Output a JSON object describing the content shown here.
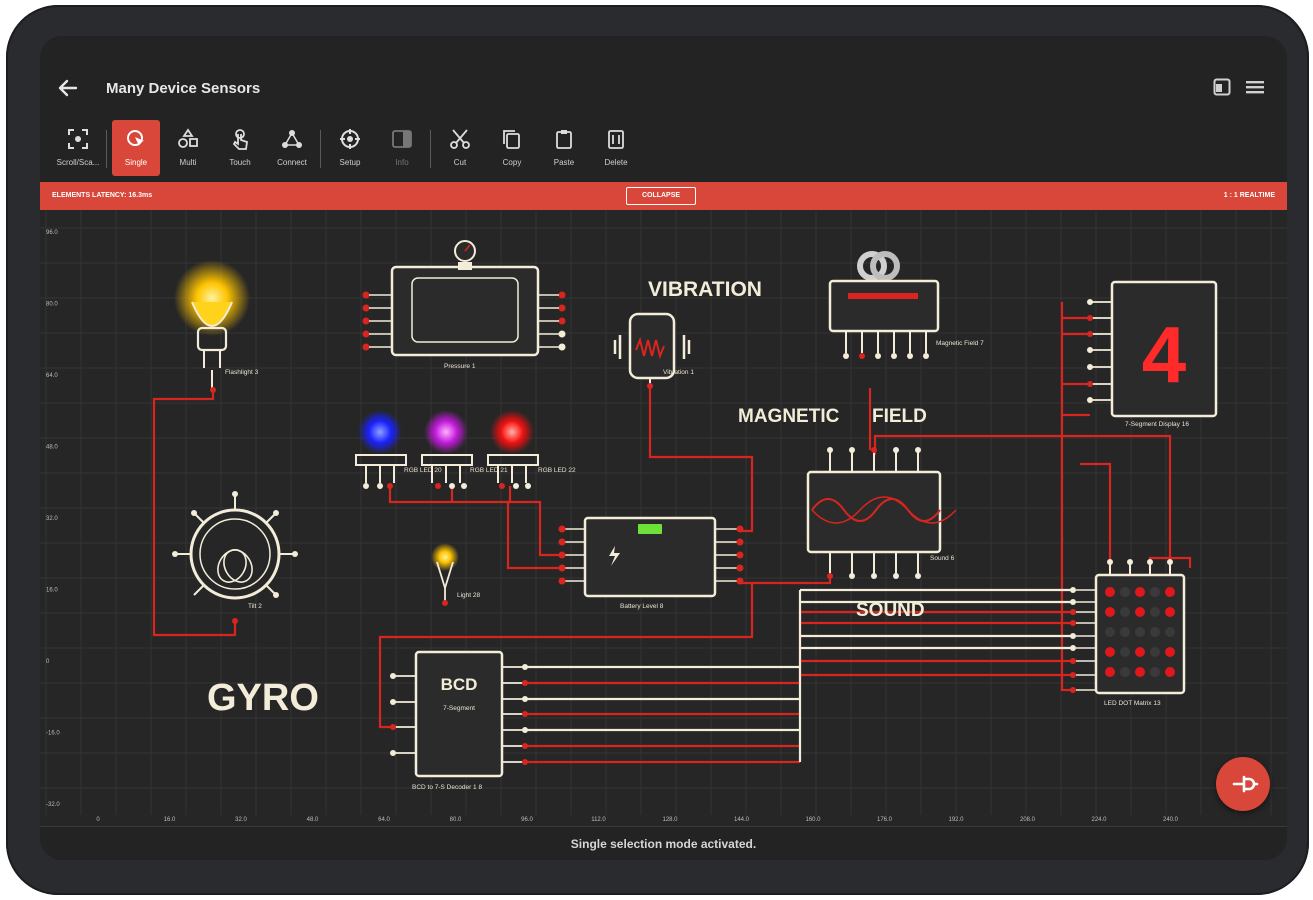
{
  "app": {
    "title": "Many Device Sensors",
    "icons": {
      "back": "arrow-left-icon",
      "action_a": "split-view-icon",
      "menu": "hamburger-menu-icon"
    }
  },
  "toolbar": {
    "tools": [
      {
        "label": "Scroll/Sca...",
        "icon": "scroll-scale-icon",
        "active": false,
        "enabled": true
      },
      {
        "label": "Single",
        "icon": "single-select-icon",
        "active": true,
        "enabled": true
      },
      {
        "label": "Multi",
        "icon": "multi-select-icon",
        "active": false,
        "enabled": true
      },
      {
        "label": "Touch",
        "icon": "touch-icon",
        "active": false,
        "enabled": true
      },
      {
        "label": "Connect",
        "icon": "connect-icon",
        "active": false,
        "enabled": true
      },
      {
        "label": "Setup",
        "icon": "setup-icon",
        "active": false,
        "enabled": true
      },
      {
        "label": "Info",
        "icon": "info-icon",
        "active": false,
        "enabled": false
      },
      {
        "label": "Cut",
        "icon": "cut-icon",
        "active": false,
        "enabled": true
      },
      {
        "label": "Copy",
        "icon": "copy-icon",
        "active": false,
        "enabled": true
      },
      {
        "label": "Paste",
        "icon": "paste-icon",
        "active": false,
        "enabled": true
      },
      {
        "label": "Delete",
        "icon": "delete-icon",
        "active": false,
        "enabled": true
      }
    ]
  },
  "banner": {
    "latency": "ELEMENTS LATENCY: 16.3ms",
    "collapse_label": "COLLAPSE",
    "realtime": "1 : 1 REALTIME",
    "color": "#d8473a"
  },
  "canvas": {
    "y_ticks": [
      "96.0",
      "80.0",
      "64.0",
      "48.0",
      "32.0",
      "16.0",
      "0",
      "-16.0",
      "-32.0"
    ],
    "x_ticks": [
      "0",
      "16.0",
      "32.0",
      "48.0",
      "64.0",
      "80.0",
      "96.0",
      "112.0",
      "128.0",
      "144.0",
      "160.0",
      "176.0",
      "192.0",
      "208.0",
      "224.0",
      "240.0"
    ],
    "labels": {
      "vibration": "VIBRATION",
      "magnetic": "MAGNETIC",
      "field": "FIELD",
      "gyro": "GYRO",
      "sound": "SOUND"
    },
    "components": {
      "flashlight": "Flashlight 3",
      "pressure": "Pressure 1",
      "vibration": "Vibration 1",
      "magnetic": "Magnetic Field 7",
      "seven_seg": "7-Segment Display 16",
      "seven_seg_digit": "4",
      "rgb_a": "RGB LED 20",
      "rgb_b": "RGB LED 21",
      "rgb_c": "RGB LED 22",
      "battery": "Battery Level 8",
      "sound": "Sound 6",
      "gyro": "Tilt 2",
      "light": "Light 28",
      "bcd": "BCD to 7-S Decoder 1 8",
      "bcd_title": "BCD",
      "bcd_sub": "7-Segment",
      "matrix": "LED DOT Matrix 13"
    },
    "wire_color": "#d8251f",
    "element_color": "#f2ecd8"
  },
  "status": {
    "message": "Single selection mode activated."
  },
  "fab": {
    "icon": "plug-icon"
  }
}
